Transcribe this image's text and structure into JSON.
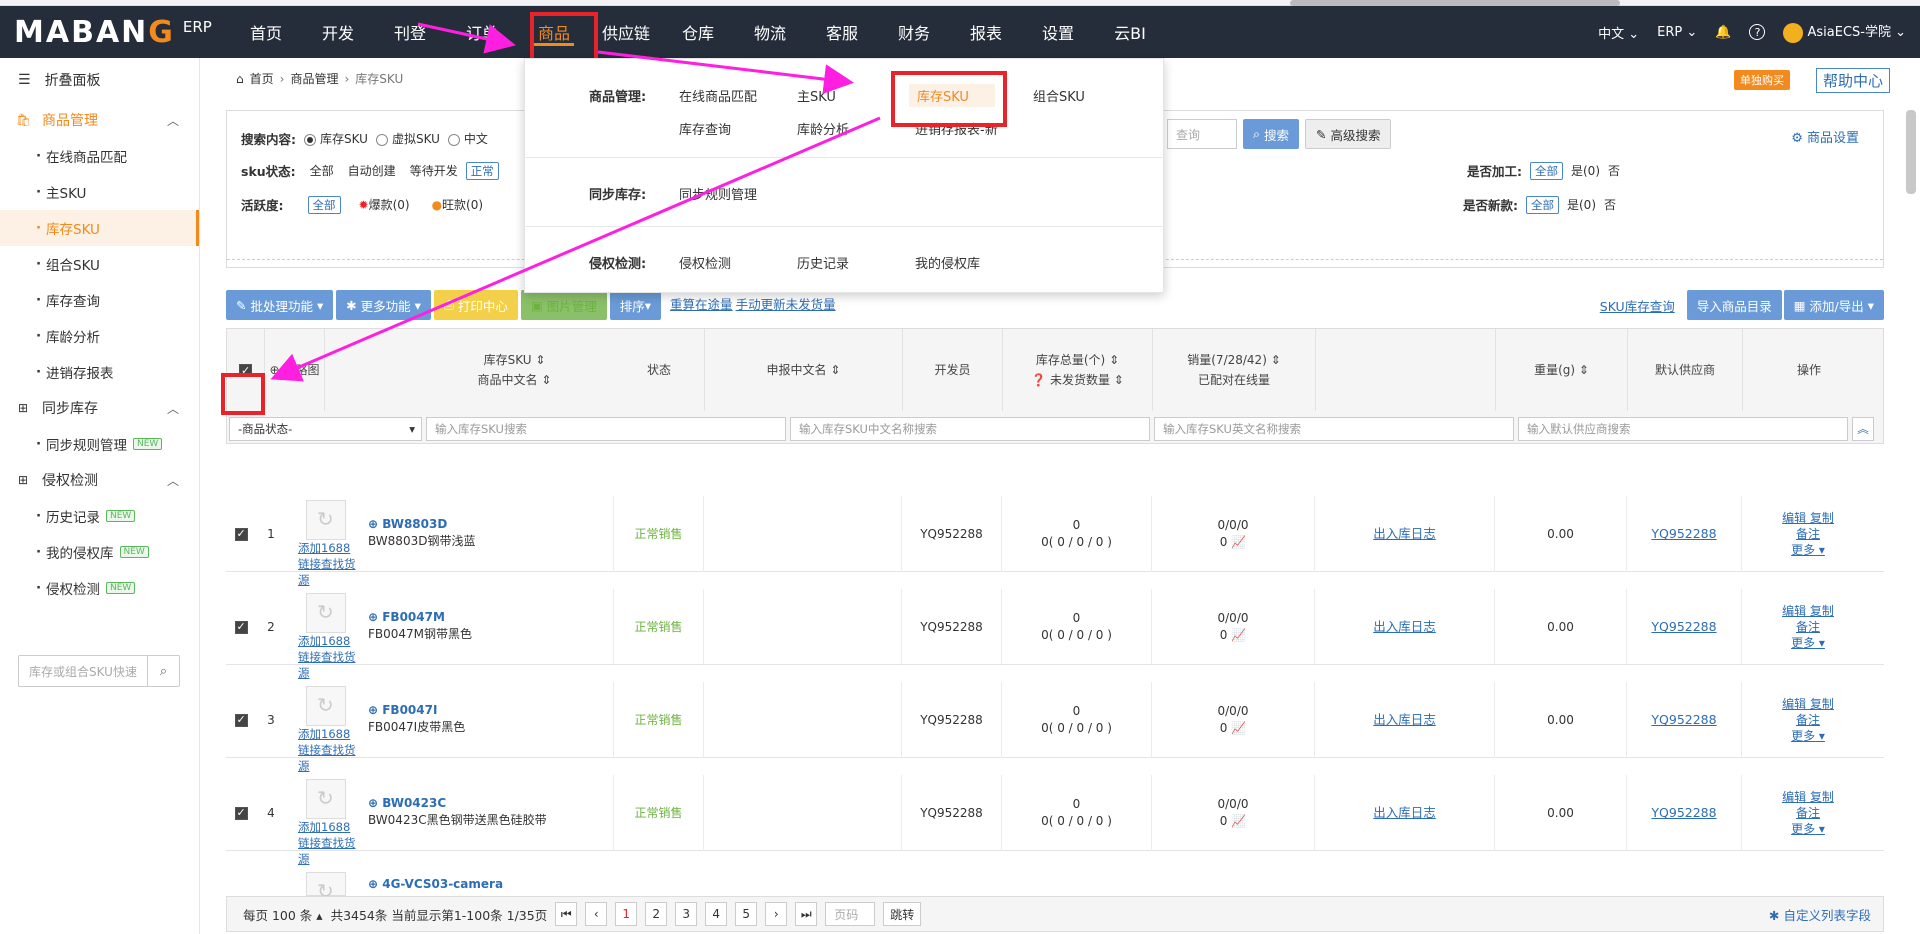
{
  "logo": {
    "prefix": "MABAN",
    "accent": "G",
    "suffix": "ERP"
  },
  "nav": [
    "首页",
    "开发",
    "刊登",
    "订单",
    "商品",
    "供应链",
    "仓库",
    "物流",
    "客服",
    "财务",
    "报表",
    "设置",
    "云BI"
  ],
  "topright": {
    "lang": "中文",
    "erp": "ERP",
    "bell": "bell-icon",
    "help": "?",
    "user": "AsiaECS-学院"
  },
  "sidebar": {
    "fold": "折叠面板",
    "groups": [
      {
        "label": "商品管理",
        "items": [
          {
            "label": "在线商品匹配"
          },
          {
            "label": "主SKU"
          },
          {
            "label": "库存SKU",
            "active": true
          },
          {
            "label": "组合SKU"
          },
          {
            "label": "库存查询"
          },
          {
            "label": "库龄分析"
          },
          {
            "label": "进销存报表"
          }
        ]
      },
      {
        "label": "同步库存",
        "items": [
          {
            "label": "同步规则管理",
            "badge": "NEW"
          }
        ]
      },
      {
        "label": "侵权检测",
        "items": [
          {
            "label": "历史记录",
            "badge": "NEW"
          },
          {
            "label": "我的侵权库",
            "badge": "NEW"
          },
          {
            "label": "侵权检测",
            "badge": "NEW"
          }
        ]
      }
    ],
    "search_placeholder": "库存或组合SKU快速"
  },
  "breadcrumb": [
    "首页",
    "商品管理",
    "库存SKU"
  ],
  "top_tags": {
    "buy": "单独购买",
    "help": "帮助中心"
  },
  "filter": {
    "search_label": "搜索内容:",
    "search_opts": [
      "库存SKU",
      "虚拟SKU",
      "中文"
    ],
    "query_placeholder": "查询",
    "search_btn": "搜索",
    "adv_btn": "高级搜索",
    "settings": "商品设置",
    "sku_status_label": "sku状态:",
    "sku_status_opts": [
      "全部",
      "自动创建",
      "等待开发",
      "正常"
    ],
    "activity_label": "活跃度:",
    "activity_opts": [
      "全部",
      "爆款(0)",
      "旺款(0)"
    ],
    "process_label": "是否加工:",
    "process_opts": [
      "全部",
      "是(0)",
      "否"
    ],
    "new_label": "是否新款:",
    "new_opts": [
      "全部",
      "是(0)",
      "否"
    ]
  },
  "toolbar": {
    "batch": "批处理功能",
    "more": "更多功能",
    "print": "打印中心",
    "image": "图片管理",
    "sort": "排序",
    "link1": "重算在途量",
    "link2": "手动更新未发货量",
    "sku_query": "SKU库存查询",
    "import": "导入商品目录",
    "add_export": "添加/导出"
  },
  "table": {
    "headers": {
      "thumb": "缩略图",
      "sku": "库存SKU",
      "cn_name": "商品中文名",
      "status": "状态",
      "declare": "申报中文名",
      "dev": "开发员",
      "stock": "库存总量(个)",
      "unshipped": "未发货数量",
      "sales": "销量(7/28/42)",
      "online": "已配对在线量",
      "weight": "重量(g)",
      "supplier": "默认供应商",
      "ops": "操作"
    },
    "filters": {
      "status_select": "-商品状态-",
      "sku_ph": "输入库存SKU搜索",
      "cn_ph": "输入库存SKU中文名称搜索",
      "en_ph": "输入库存SKU英文名称搜索",
      "supplier_ph": "输入默认供应商搜索"
    },
    "rows": [
      {
        "n": "1",
        "code": "BW8803D",
        "name": "BW8803D钢带浅蓝",
        "status": "正常销售",
        "dev": "YQ952288",
        "stock": "0",
        "unsh": "0( 0 / 0 / 0 )",
        "sales": "0/0/0",
        "online": "0",
        "log": "出入库日志",
        "weight": "0.00",
        "supplier": "YQ952288"
      },
      {
        "n": "2",
        "code": "FB0047M",
        "name": "FB0047M钢带黑色",
        "status": "正常销售",
        "dev": "YQ952288",
        "stock": "0",
        "unsh": "0( 0 / 0 / 0 )",
        "sales": "0/0/0",
        "online": "0",
        "log": "出入库日志",
        "weight": "0.00",
        "supplier": "YQ952288"
      },
      {
        "n": "3",
        "code": "FB0047I",
        "name": "FB0047I皮带黑色",
        "status": "正常销售",
        "dev": "YQ952288",
        "stock": "0",
        "unsh": "0( 0 / 0 / 0 )",
        "sales": "0/0/0",
        "online": "0",
        "log": "出入库日志",
        "weight": "0.00",
        "supplier": "YQ952288"
      },
      {
        "n": "4",
        "code": "BW0423C",
        "name": "BW0423C黑色钢带送黑色硅胶带",
        "status": "正常销售",
        "dev": "YQ952288",
        "stock": "0",
        "unsh": "0( 0 / 0 / 0 )",
        "sales": "0/0/0",
        "online": "0",
        "log": "出入库日志",
        "weight": "0.00",
        "supplier": "YQ952288"
      }
    ],
    "partial_row_code": "4G-VCS03-camera",
    "thumb_link": "添加1688链接查找货源",
    "ops": {
      "edit": "编辑",
      "copy": "复制",
      "note": "备注",
      "more": "更多"
    }
  },
  "footer": {
    "per_page": "每页 100 条",
    "summary": "共3454条 当前显示第1-100条 1/35页",
    "pages": [
      "1",
      "2",
      "3",
      "4",
      "5"
    ],
    "page_ph": "页码",
    "jump": "跳转",
    "custom": "自定义列表字段"
  },
  "dropdown": {
    "sections": [
      {
        "label": "商品管理:",
        "items": [
          "在线商品匹配",
          "主SKU",
          "库存SKU",
          "组合SKU",
          "库存查询",
          "库龄分析",
          "进销存报表-新"
        ]
      },
      {
        "label": "同步库存:",
        "items": [
          "同步规则管理"
        ]
      },
      {
        "label": "侵权检测:",
        "items": [
          "侵权检测",
          "历史记录",
          "我的侵权库"
        ]
      }
    ]
  },
  "colors": {
    "accent": "#f28a1e",
    "topbar": "#252c3a",
    "link": "#2d6db5",
    "highlight": "#e8232a",
    "arrow": "#ff1fe0"
  }
}
